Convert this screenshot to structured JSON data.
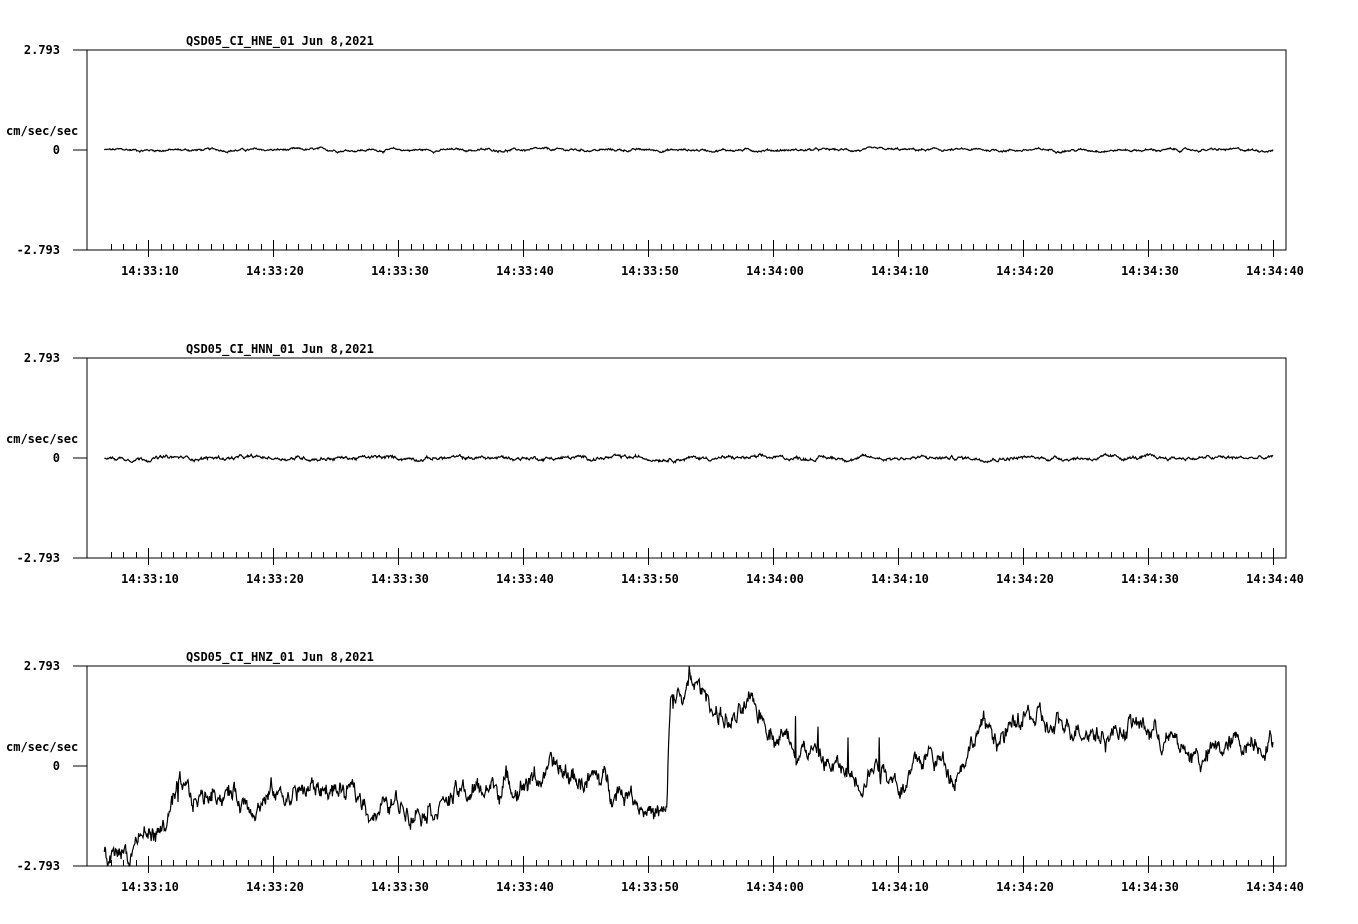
{
  "chart_data": [
    {
      "type": "line",
      "title": "QSD05_CI_HNE_01  Jun 8,2021",
      "ylabel": "cm/sec/sec",
      "ylim": [
        -2.793,
        2.793
      ],
      "ytick_labels": [
        "2.793",
        "0",
        "-2.793"
      ],
      "xlim": [
        "14:33:05",
        "14:34:40"
      ],
      "xtick_labels": [
        "14:33:10",
        "14:33:20",
        "14:33:30",
        "14:33:40",
        "14:33:50",
        "14:34:00",
        "14:34:10",
        "14:34:20",
        "14:34:30",
        "14:34:40"
      ],
      "series": [
        {
          "x_start": "14:33:06.5",
          "x_end": "14:34:40",
          "noise_amplitude": 0.02,
          "events": []
        }
      ]
    },
    {
      "type": "line",
      "title": "QSD05_CI_HNN_01  Jun 8,2021",
      "ylabel": "cm/sec/sec",
      "ylim": [
        -2.793,
        2.793
      ],
      "ytick_labels": [
        "2.793",
        "0",
        "-2.793"
      ],
      "xlim": [
        "14:33:05",
        "14:34:40"
      ],
      "xtick_labels": [
        "14:33:10",
        "14:33:20",
        "14:33:30",
        "14:33:40",
        "14:33:50",
        "14:34:00",
        "14:34:10",
        "14:34:20",
        "14:34:30",
        "14:34:40"
      ],
      "series": [
        {
          "x_start": "14:33:06.5",
          "x_end": "14:34:40",
          "noise_amplitude": 0.03,
          "events": []
        }
      ]
    },
    {
      "type": "line",
      "title": "QSD05_CI_HNZ_01  Jun 8,2021",
      "ylabel": "cm/sec/sec",
      "ylim": [
        -2.793,
        2.793
      ],
      "ytick_labels": [
        "2.793",
        "0",
        "-2.793"
      ],
      "xlim": [
        "14:33:05",
        "14:34:40"
      ],
      "xtick_labels": [
        "14:33:10",
        "14:33:20",
        "14:33:30",
        "14:33:40",
        "14:33:50",
        "14:34:00",
        "14:34:10",
        "14:34:20",
        "14:34:30",
        "14:34:40"
      ],
      "series": [
        {
          "x_start": "14:33:06.5",
          "x_end": "14:34:40",
          "noise_amplitude": 0.18,
          "baseline": [
            [
              1.5,
              -2.3
            ],
            [
              2.0,
              -2.6
            ],
            [
              3.0,
              -2.2
            ],
            [
              3.5,
              -2.5
            ],
            [
              4.0,
              -2.0
            ],
            [
              5.0,
              -1.9
            ],
            [
              6.0,
              -1.8
            ],
            [
              7.5,
              -0.9
            ],
            [
              8.5,
              -1.1
            ],
            [
              9.5,
              -0.9
            ],
            [
              10.5,
              -0.6
            ],
            [
              12.5,
              -0.9
            ],
            [
              15.5,
              -0.8
            ],
            [
              19.5,
              -0.6
            ],
            [
              23.5,
              -1.2
            ],
            [
              26.5,
              -1.0
            ],
            [
              30.5,
              -0.8
            ],
            [
              33.5,
              -0.5
            ],
            [
              37.5,
              -0.2
            ],
            [
              40.5,
              -0.4
            ],
            [
              43.5,
              -0.6
            ],
            [
              45.5,
              -1.3
            ],
            [
              46.5,
              -1.5
            ],
            [
              46.8,
              1.8
            ],
            [
              47.5,
              1.9
            ],
            [
              48.5,
              2.2
            ],
            [
              49.5,
              2.0
            ],
            [
              51.5,
              1.2
            ],
            [
              53.5,
              1.5
            ],
            [
              55.5,
              1.0
            ],
            [
              57.5,
              0.6
            ],
            [
              59.5,
              0.0
            ],
            [
              61.5,
              -0.3
            ],
            [
              63.5,
              0.2
            ],
            [
              65.5,
              -0.5
            ],
            [
              67.5,
              0.3
            ],
            [
              69.5,
              -0.1
            ],
            [
              71.5,
              1.1
            ],
            [
              73.5,
              0.8
            ],
            [
              75.5,
              1.4
            ],
            [
              77.5,
              0.9
            ],
            [
              79.5,
              1.3
            ],
            [
              81.5,
              0.9
            ],
            [
              83.5,
              1.2
            ],
            [
              85.5,
              1.0
            ],
            [
              87.5,
              0.5
            ],
            [
              89.5,
              0.2
            ],
            [
              91.5,
              0.5
            ],
            [
              93.5,
              0.8
            ]
          ],
          "spikes": [
            [
              1.9,
              -2.7
            ],
            [
              7.4,
              -1.0
            ],
            [
              8.5,
              -1.1
            ],
            [
              47.0,
              1.6
            ],
            [
              48.3,
              2.8
            ],
            [
              53.0,
              1.8
            ],
            [
              56.8,
              1.4
            ],
            [
              58.6,
              1.1
            ],
            [
              61.0,
              0.8
            ],
            [
              62.2,
              -0.8
            ],
            [
              63.5,
              0.8
            ]
          ]
        }
      ]
    }
  ]
}
